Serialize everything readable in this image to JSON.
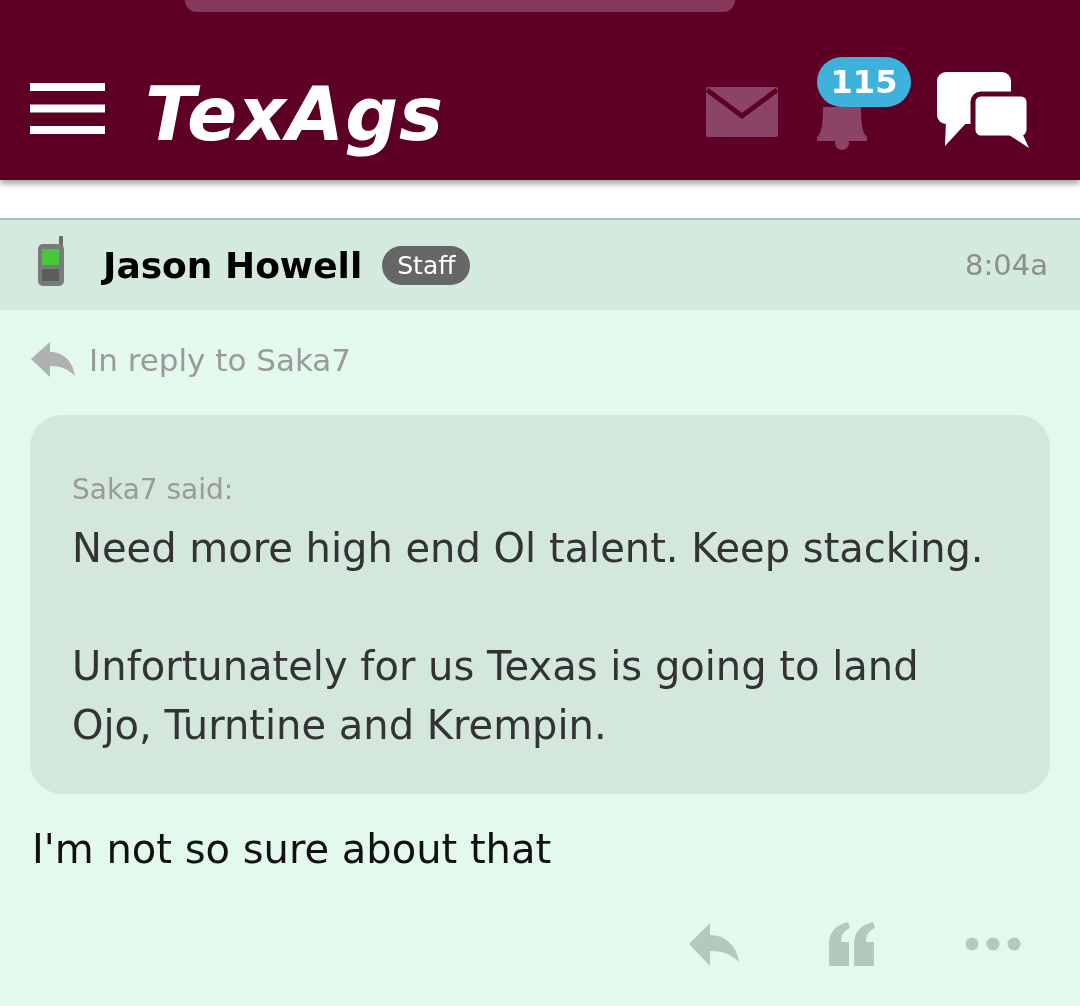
{
  "header": {
    "logo": "TexAgs",
    "notification_count": "115"
  },
  "post": {
    "author": "Jason Howell",
    "role_badge": "Staff",
    "time": "8:04a",
    "in_reply_to": "In reply to Saka7",
    "quote": {
      "attribution": "Saka7 said:",
      "paragraphs": [
        "Need more high end Ol talent. Keep stacking.",
        "Unfortunately for us Texas is going to land Ojo, Turntine and Krempin."
      ]
    },
    "body": "I'm not so sure about that"
  }
}
